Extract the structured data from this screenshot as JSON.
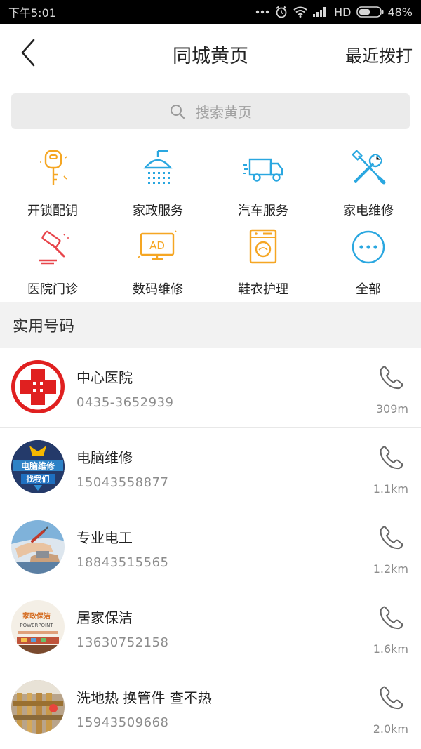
{
  "status_bar": {
    "time": "下午5:01",
    "network": "HD",
    "battery": "48%"
  },
  "header": {
    "title": "同城黄页",
    "right_action": "最近拨打",
    "back_icon": "chevron-left-icon"
  },
  "search": {
    "placeholder": "搜索黄页",
    "icon": "search-icon"
  },
  "categories": [
    {
      "label": "开锁配钥",
      "icon": "key-icon",
      "color": "#f5a623"
    },
    {
      "label": "家政服务",
      "icon": "shower-icon",
      "color": "#2aa7e0"
    },
    {
      "label": "汽车服务",
      "icon": "truck-icon",
      "color": "#2aa7e0"
    },
    {
      "label": "家电维修",
      "icon": "tools-icon",
      "color": "#2aa7e0"
    },
    {
      "label": "医院门诊",
      "icon": "gavel-icon",
      "color": "#e8454b"
    },
    {
      "label": "数码维修",
      "icon": "ad-monitor-icon",
      "color": "#f5a623"
    },
    {
      "label": "鞋衣护理",
      "icon": "washing-machine-icon",
      "color": "#f5a623"
    },
    {
      "label": "全部",
      "icon": "more-icon",
      "color": "#2aa7e0"
    }
  ],
  "section_title": "实用号码",
  "contacts": [
    {
      "name": "中心医院",
      "phone": "0435-3652939",
      "distance": "309m",
      "avatar": "red-cross-avatar"
    },
    {
      "name": "电脑维修",
      "phone": "15043558877",
      "distance": "1.1km",
      "avatar": "computer-repair-avatar",
      "avatar_text": [
        "电脑维修",
        "找我们"
      ]
    },
    {
      "name": "专业电工",
      "phone": "18843515565",
      "distance": "1.2km",
      "avatar": "electrician-avatar"
    },
    {
      "name": "居家保洁",
      "phone": "13630752158",
      "distance": "1.6km",
      "avatar": "cleaning-avatar",
      "avatar_text": [
        "家政保洁",
        "POWERPOINT"
      ]
    },
    {
      "name": "洗地热 换管件 查不热",
      "phone": "15943509668",
      "distance": "2.0km",
      "avatar": "pipes-avatar"
    }
  ]
}
